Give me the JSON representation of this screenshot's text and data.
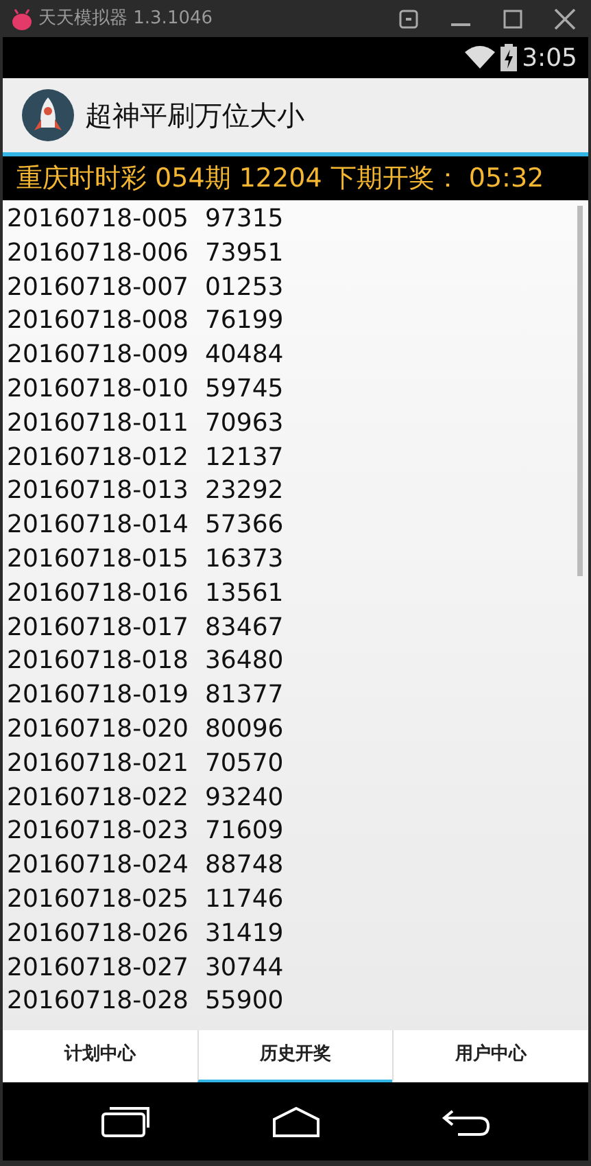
{
  "window": {
    "title": "天天模拟器 1.3.1046"
  },
  "status_bar": {
    "time": "3:05"
  },
  "app_bar": {
    "title": "超神平刷万位大小"
  },
  "banner": {
    "text": "重庆时时彩 054期 12204 下期开奖： 05:32"
  },
  "draws": [
    {
      "period": "20160718-005",
      "number": "97315"
    },
    {
      "period": "20160718-006",
      "number": "73951"
    },
    {
      "period": "20160718-007",
      "number": "01253"
    },
    {
      "period": "20160718-008",
      "number": "76199"
    },
    {
      "period": "20160718-009",
      "number": "40484"
    },
    {
      "period": "20160718-010",
      "number": "59745"
    },
    {
      "period": "20160718-011",
      "number": "70963"
    },
    {
      "period": "20160718-012",
      "number": "12137"
    },
    {
      "period": "20160718-013",
      "number": "23292"
    },
    {
      "period": "20160718-014",
      "number": "57366"
    },
    {
      "period": "20160718-015",
      "number": "16373"
    },
    {
      "period": "20160718-016",
      "number": "13561"
    },
    {
      "period": "20160718-017",
      "number": "83467"
    },
    {
      "period": "20160718-018",
      "number": "36480"
    },
    {
      "period": "20160718-019",
      "number": "81377"
    },
    {
      "period": "20160718-020",
      "number": "80096"
    },
    {
      "period": "20160718-021",
      "number": "70570"
    },
    {
      "period": "20160718-022",
      "number": "93240"
    },
    {
      "period": "20160718-023",
      "number": "71609"
    },
    {
      "period": "20160718-024",
      "number": "88748"
    },
    {
      "period": "20160718-025",
      "number": "11746"
    },
    {
      "period": "20160718-026",
      "number": "31419"
    },
    {
      "period": "20160718-027",
      "number": "30744"
    },
    {
      "period": "20160718-028",
      "number": "55900"
    }
  ],
  "tabs": [
    {
      "label": "计划中心",
      "selected": false
    },
    {
      "label": "历史开奖",
      "selected": true
    },
    {
      "label": "用户中心",
      "selected": false
    }
  ]
}
